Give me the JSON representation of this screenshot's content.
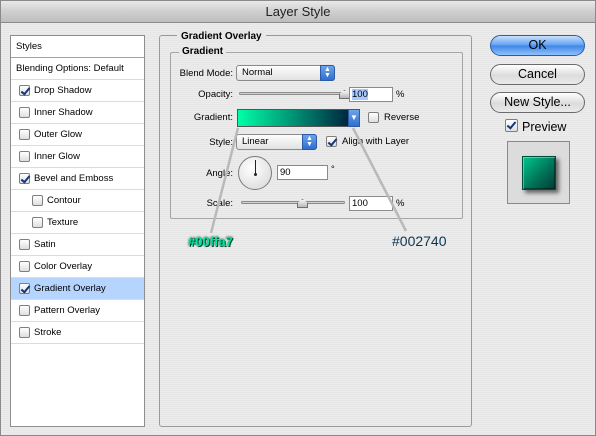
{
  "window": {
    "title": "Layer Style"
  },
  "sidebar": {
    "header": "Styles",
    "items": [
      {
        "label": "Blending Options: Default",
        "checkbox": false,
        "checked": false,
        "indent": 0,
        "selected": false
      },
      {
        "label": "Drop Shadow",
        "checkbox": true,
        "checked": true,
        "indent": 0,
        "selected": false
      },
      {
        "label": "Inner Shadow",
        "checkbox": true,
        "checked": false,
        "indent": 0,
        "selected": false
      },
      {
        "label": "Outer Glow",
        "checkbox": true,
        "checked": false,
        "indent": 0,
        "selected": false
      },
      {
        "label": "Inner Glow",
        "checkbox": true,
        "checked": false,
        "indent": 0,
        "selected": false
      },
      {
        "label": "Bevel and Emboss",
        "checkbox": true,
        "checked": true,
        "indent": 0,
        "selected": false
      },
      {
        "label": "Contour",
        "checkbox": true,
        "checked": false,
        "indent": 1,
        "selected": false
      },
      {
        "label": "Texture",
        "checkbox": true,
        "checked": false,
        "indent": 1,
        "selected": false
      },
      {
        "label": "Satin",
        "checkbox": true,
        "checked": false,
        "indent": 0,
        "selected": false
      },
      {
        "label": "Color Overlay",
        "checkbox": true,
        "checked": false,
        "indent": 0,
        "selected": false
      },
      {
        "label": "Gradient Overlay",
        "checkbox": true,
        "checked": true,
        "indent": 0,
        "selected": true
      },
      {
        "label": "Pattern Overlay",
        "checkbox": true,
        "checked": false,
        "indent": 0,
        "selected": false
      },
      {
        "label": "Stroke",
        "checkbox": true,
        "checked": false,
        "indent": 0,
        "selected": false
      }
    ]
  },
  "panel": {
    "title": "Gradient Overlay",
    "group_title": "Gradient",
    "blend_mode": {
      "label": "Blend Mode:",
      "value": "Normal"
    },
    "opacity": {
      "label": "Opacity:",
      "value": "100",
      "unit": "%",
      "level": 1.0
    },
    "gradient": {
      "label": "Gradient:",
      "start_color": "#00ffa7",
      "end_color": "#002740",
      "reverse": {
        "label": "Reverse",
        "checked": false
      }
    },
    "style": {
      "label": "Style:",
      "value": "Linear",
      "align_with_layer": {
        "label": "Align with Layer",
        "checked": true
      }
    },
    "angle": {
      "label": "Angle:",
      "value": "90",
      "unit": "°"
    },
    "scale": {
      "label": "Scale:",
      "value": "100",
      "unit": "%",
      "level": 0.5
    }
  },
  "annotations": {
    "start": "#00ffa7",
    "end": "#002740"
  },
  "buttons": {
    "ok": "OK",
    "cancel": "Cancel",
    "new_style": "New Style..."
  },
  "preview": {
    "label": "Preview",
    "checked": true
  }
}
